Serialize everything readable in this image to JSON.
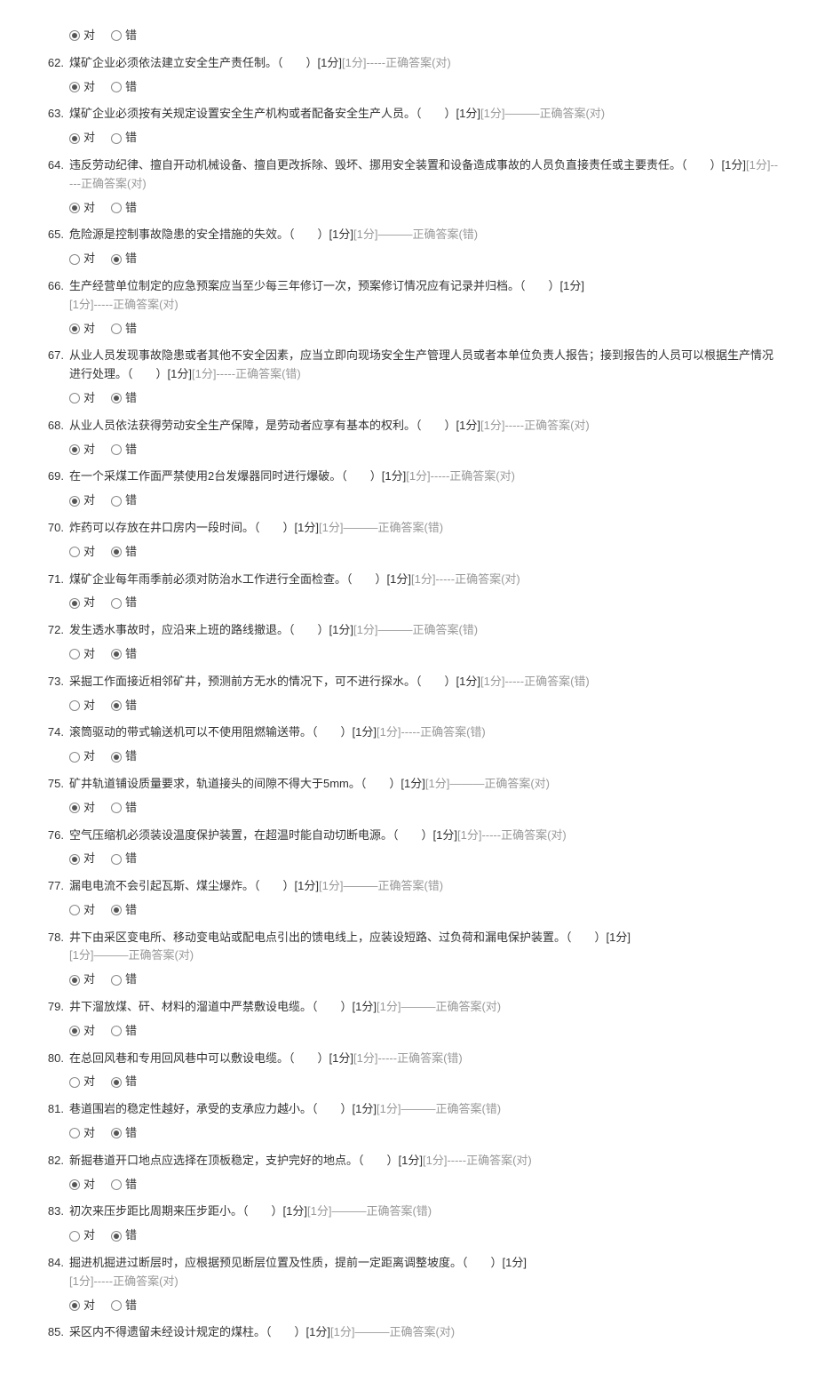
{
  "labels": {
    "correct": "对",
    "wrong": "错"
  },
  "questions": [
    {
      "num": "",
      "text": "",
      "score": "",
      "ans": "",
      "sel": "对",
      "onlyChoices": true
    },
    {
      "num": "62.",
      "text": "煤矿企业必须依法建立安全生产责任制。（　　）",
      "score": "[1分]",
      "ans": "[1分]-----正确答案(对)",
      "sel": "对"
    },
    {
      "num": "63.",
      "text": "煤矿企业必须按有关规定设置安全生产机构或者配备安全生产人员。（　　）",
      "score": "[1分]",
      "ans": "[1分]———正确答案(对)",
      "sel": "对"
    },
    {
      "num": "64.",
      "text": "违反劳动纪律、擅自开动机械设备、擅自更改拆除、毁坏、挪用安全装置和设备造成事故的人员负直接责任或主要责任。（　　）",
      "score": "[1分]",
      "ans": "[1分]-----正确答案(对)",
      "sel": "对"
    },
    {
      "num": "65.",
      "text": "危险源是控制事故隐患的安全措施的失效。（　　）",
      "score": "[1分]",
      "ans": "[1分]———正确答案(错)",
      "sel": "错"
    },
    {
      "num": "66.",
      "text": "生产经营单位制定的应急预案应当至少每三年修订一次，预案修订情况应有记录并归档。（　　）",
      "score": "[1分]",
      "ans": "[1分]-----正确答案(对)",
      "sel": "对",
      "ansNewLine": true
    },
    {
      "num": "67.",
      "text": "从业人员发现事故隐患或者其他不安全因素，应当立即向现场安全生产管理人员或者本单位负责人报告；接到报告的人员可以根据生产情况进行处理。（　　）",
      "score": "[1分]",
      "ans": "[1分]-----正确答案(错)",
      "sel": "错"
    },
    {
      "num": "68.",
      "text": "从业人员依法获得劳动安全生产保障，是劳动者应享有基本的权利。（　　）",
      "score": "[1分]",
      "ans": "[1分]-----正确答案(对)",
      "sel": "对"
    },
    {
      "num": "69.",
      "text": "在一个采煤工作面严禁使用2台发爆器同时进行爆破。（　　）",
      "score": "[1分]",
      "ans": "[1分]-----正确答案(对)",
      "sel": "对"
    },
    {
      "num": "70.",
      "text": "炸药可以存放在井口房内一段时间。（　　）",
      "score": "[1分]",
      "ans": "[1分]———正确答案(错)",
      "sel": "错"
    },
    {
      "num": "71.",
      "text": "煤矿企业每年雨季前必须对防治水工作进行全面检查。（　　）",
      "score": "[1分]",
      "ans": "[1分]-----正确答案(对)",
      "sel": "对"
    },
    {
      "num": "72.",
      "text": "发生透水事故时，应沿来上班的路线撤退。（　　）",
      "score": "[1分]",
      "ans": "[1分]———正确答案(错)",
      "sel": "错"
    },
    {
      "num": "73.",
      "text": "采掘工作面接近相邻矿井，预测前方无水的情况下，可不进行探水。（　　）",
      "score": "[1分]",
      "ans": "[1分]-----正确答案(错)",
      "sel": "错"
    },
    {
      "num": "74.",
      "text": "滚筒驱动的带式输送机可以不使用阻燃输送带。（　　）",
      "score": "[1分]",
      "ans": "[1分]-----正确答案(错)",
      "sel": "错"
    },
    {
      "num": "75.",
      "text": "矿井轨道铺设质量要求，轨道接头的间隙不得大于5mm。（　　）",
      "score": "[1分]",
      "ans": "[1分]———正确答案(对)",
      "sel": "对"
    },
    {
      "num": "76.",
      "text": "空气压缩机必须装设温度保护装置，在超温时能自动切断电源。（　　）",
      "score": "[1分]",
      "ans": "[1分]-----正确答案(对)",
      "sel": "对"
    },
    {
      "num": "77.",
      "text": "漏电电流不会引起瓦斯、煤尘爆炸。（　　）",
      "score": "[1分]",
      "ans": "[1分]———正确答案(错)",
      "sel": "错"
    },
    {
      "num": "78.",
      "text": "井下由采区变电所、移动变电站或配电点引出的馈电线上，应装设短路、过负荷和漏电保护装置。（　　）",
      "score": "[1分]",
      "ans": "[1分]———正确答案(对)",
      "sel": "对",
      "ansNewLine": true
    },
    {
      "num": "79.",
      "text": "井下溜放煤、矸、材料的溜道中严禁敷设电缆。（　　）",
      "score": "[1分]",
      "ans": "[1分]———正确答案(对)",
      "sel": "对"
    },
    {
      "num": "80.",
      "text": "在总回风巷和专用回风巷中可以敷设电缆。（　　）",
      "score": "[1分]",
      "ans": "[1分]-----正确答案(错)",
      "sel": "错"
    },
    {
      "num": "81.",
      "text": "巷道围岩的稳定性越好，承受的支承应力越小。（　　）",
      "score": "[1分]",
      "ans": "[1分]———正确答案(错)",
      "sel": "错"
    },
    {
      "num": "82.",
      "text": "新掘巷道开口地点应选择在顶板稳定，支护完好的地点。（　　）",
      "score": "[1分]",
      "ans": "[1分]-----正确答案(对)",
      "sel": "对"
    },
    {
      "num": "83.",
      "text": "初次来压步距比周期来压步距小。（　　）",
      "score": "[1分]",
      "ans": "[1分]———正确答案(错)",
      "sel": "错"
    },
    {
      "num": "84.",
      "text": "掘进机掘进过断层时，应根据预见断层位置及性质，提前一定距离调整坡度。（　　）",
      "score": "[1分]",
      "ans": "[1分]-----正确答案(对)",
      "sel": "对",
      "ansNewLine": true
    },
    {
      "num": "85.",
      "text": "采区内不得遗留未经设计规定的煤柱。（　　）",
      "score": "[1分]",
      "ans": "[1分]———正确答案(对)",
      "sel": "",
      "noChoices": true
    }
  ]
}
